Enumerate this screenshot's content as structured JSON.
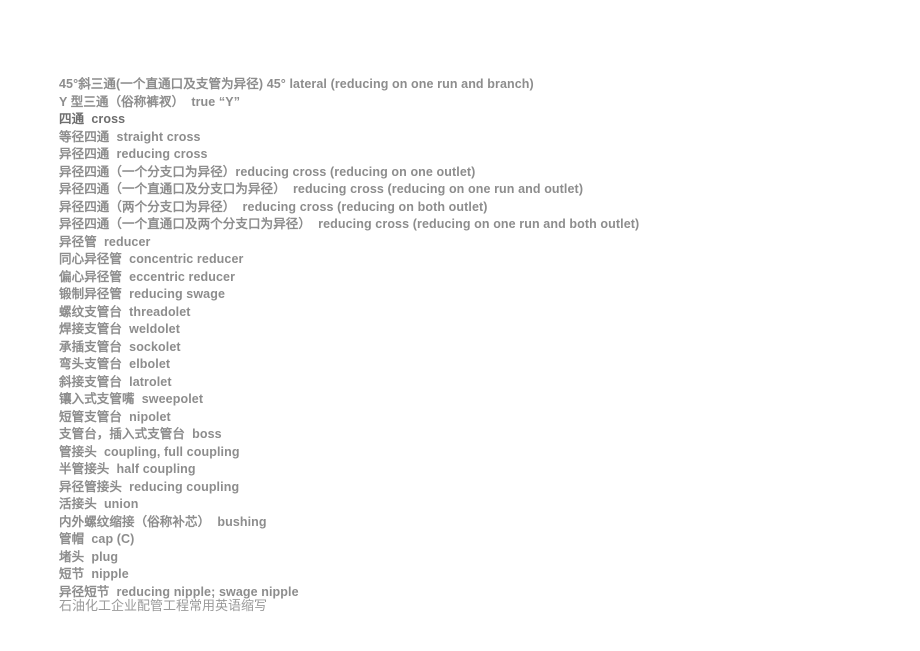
{
  "document": {
    "background_color": "#ffffff",
    "text_color": "#8d8d8d",
    "emphasis_color": "#6e6e6e",
    "footer_color": "#9a9a9a",
    "glossary": [
      {
        "text": "45°斜三通(一个直通口及支管为异径) 45° lateral (reducing on one run and branch)",
        "emphasis": false
      },
      {
        "text": "Y 型三通（俗称裤衩）  true “Y”",
        "emphasis": false
      },
      {
        "text": "四通  cross",
        "emphasis": true
      },
      {
        "text": "等径四通  straight cross",
        "emphasis": false
      },
      {
        "text": "异径四通  reducing cross",
        "emphasis": false
      },
      {
        "text": "异径四通（一个分支口为异径）reducing cross (reducing on one outlet)",
        "emphasis": false
      },
      {
        "text": "异径四通（一个直通口及分支口为异径）  reducing cross (reducing on one run and outlet)",
        "emphasis": false
      },
      {
        "text": "异径四通（两个分支口为异径）  reducing cross (reducing on both outlet)",
        "emphasis": false
      },
      {
        "text": "异径四通（一个直通口及两个分支口为异径）  reducing cross (reducing on one run and both outlet)",
        "emphasis": false
      },
      {
        "text": "异径管  reducer",
        "emphasis": false
      },
      {
        "text": "同心异径管  concentric reducer",
        "emphasis": false
      },
      {
        "text": "偏心异径管  eccentric reducer",
        "emphasis": false
      },
      {
        "text": "锻制异径管  reducing swage",
        "emphasis": false
      },
      {
        "text": "螺纹支管台  threadolet",
        "emphasis": false
      },
      {
        "text": "焊接支管台  weldolet",
        "emphasis": false
      },
      {
        "text": "承插支管台  sockolet",
        "emphasis": false
      },
      {
        "text": "弯头支管台  elbolet",
        "emphasis": false
      },
      {
        "text": "斜接支管台  latrolet",
        "emphasis": false
      },
      {
        "text": "镶入式支管嘴  sweepolet",
        "emphasis": false
      },
      {
        "text": "短管支管台  nipolet",
        "emphasis": false
      },
      {
        "text": "支管台，插入式支管台  boss",
        "emphasis": false
      },
      {
        "text": "管接头  coupling, full coupling",
        "emphasis": false
      },
      {
        "text": "半管接头  half coupling",
        "emphasis": false
      },
      {
        "text": "异径管接头  reducing coupling",
        "emphasis": false
      },
      {
        "text": "活接头  union",
        "emphasis": false
      },
      {
        "text": "内外螺纹缩接（俗称补芯）  bushing",
        "emphasis": false
      },
      {
        "text": "管帽  cap (C)",
        "emphasis": false
      },
      {
        "text": "堵头  plug",
        "emphasis": false
      },
      {
        "text": "短节  nipple",
        "emphasis": false
      },
      {
        "text": "异径短节  reducing nipple; swage nipple",
        "emphasis": false
      }
    ],
    "footer_note": "石油化工企业配管工程常用英语缩写"
  }
}
